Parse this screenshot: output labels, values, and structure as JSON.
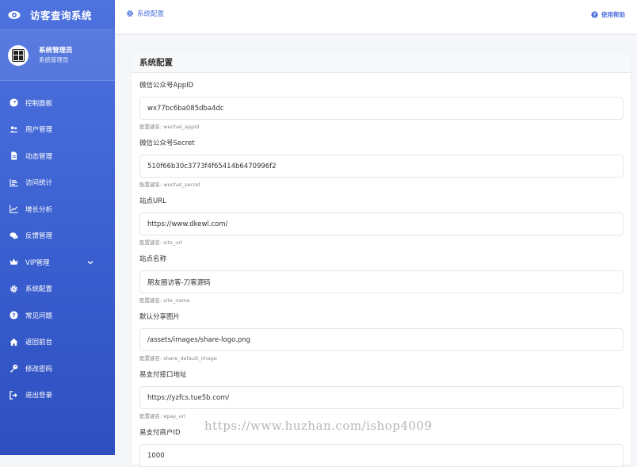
{
  "brand": {
    "title": "访客查询系统",
    "icon": "eye-icon"
  },
  "user": {
    "name": "系统管理员",
    "role": "系统管理员",
    "avatar_icon": "qr-avatar-icon"
  },
  "nav": [
    {
      "label": "控制面板",
      "icon": "dashboard-icon"
    },
    {
      "label": "用户管理",
      "icon": "users-icon"
    },
    {
      "label": "动态管理",
      "icon": "file-icon"
    },
    {
      "label": "访问统计",
      "icon": "bar-list-icon"
    },
    {
      "label": "增长分析",
      "icon": "line-chart-icon"
    },
    {
      "label": "反馈管理",
      "icon": "comments-icon"
    },
    {
      "label": "VIP管理",
      "icon": "crown-icon",
      "expandable": true
    },
    {
      "label": "系统配置",
      "icon": "gear-icon"
    },
    {
      "label": "常见问题",
      "icon": "question-icon"
    },
    {
      "label": "返回前台",
      "icon": "home-icon"
    },
    {
      "label": "修改密码",
      "icon": "key-icon"
    },
    {
      "label": "退出登录",
      "icon": "logout-icon"
    }
  ],
  "topbar": {
    "breadcrumb": "系统配置",
    "help_label": "使用帮助"
  },
  "card": {
    "title": "系统配置",
    "fields": [
      {
        "label": "微信公众号AppID",
        "value": "wx77bc6ba085dba4dc",
        "hint": "配置键名: wechat_appid"
      },
      {
        "label": "微信公众号Secret",
        "value": "510f66b30c3773f4f65414b6470996f2",
        "hint": "配置键名: wechat_secret"
      },
      {
        "label": "站点URL",
        "value": "https://www.dkewl.com/",
        "hint": "配置键名: site_url"
      },
      {
        "label": "站点名称",
        "value": "朋友圈访客-刀客源码",
        "hint": "配置键名: site_name"
      },
      {
        "label": "默认分享图片",
        "value": "/assets/images/share-logo.png",
        "hint": "配置键名: share_default_image"
      },
      {
        "label": "易支付接口地址",
        "value": "https://yzfcs.tue5b.com/",
        "hint": "配置键名: epay_url"
      },
      {
        "label": "易支付商户ID",
        "value": "1000",
        "hint": ""
      }
    ]
  },
  "watermark": "https://www.huzhan.com/ishop4009",
  "colors": {
    "primary": "#4e73df",
    "sidebar_bottom": "#2e4fc0"
  }
}
